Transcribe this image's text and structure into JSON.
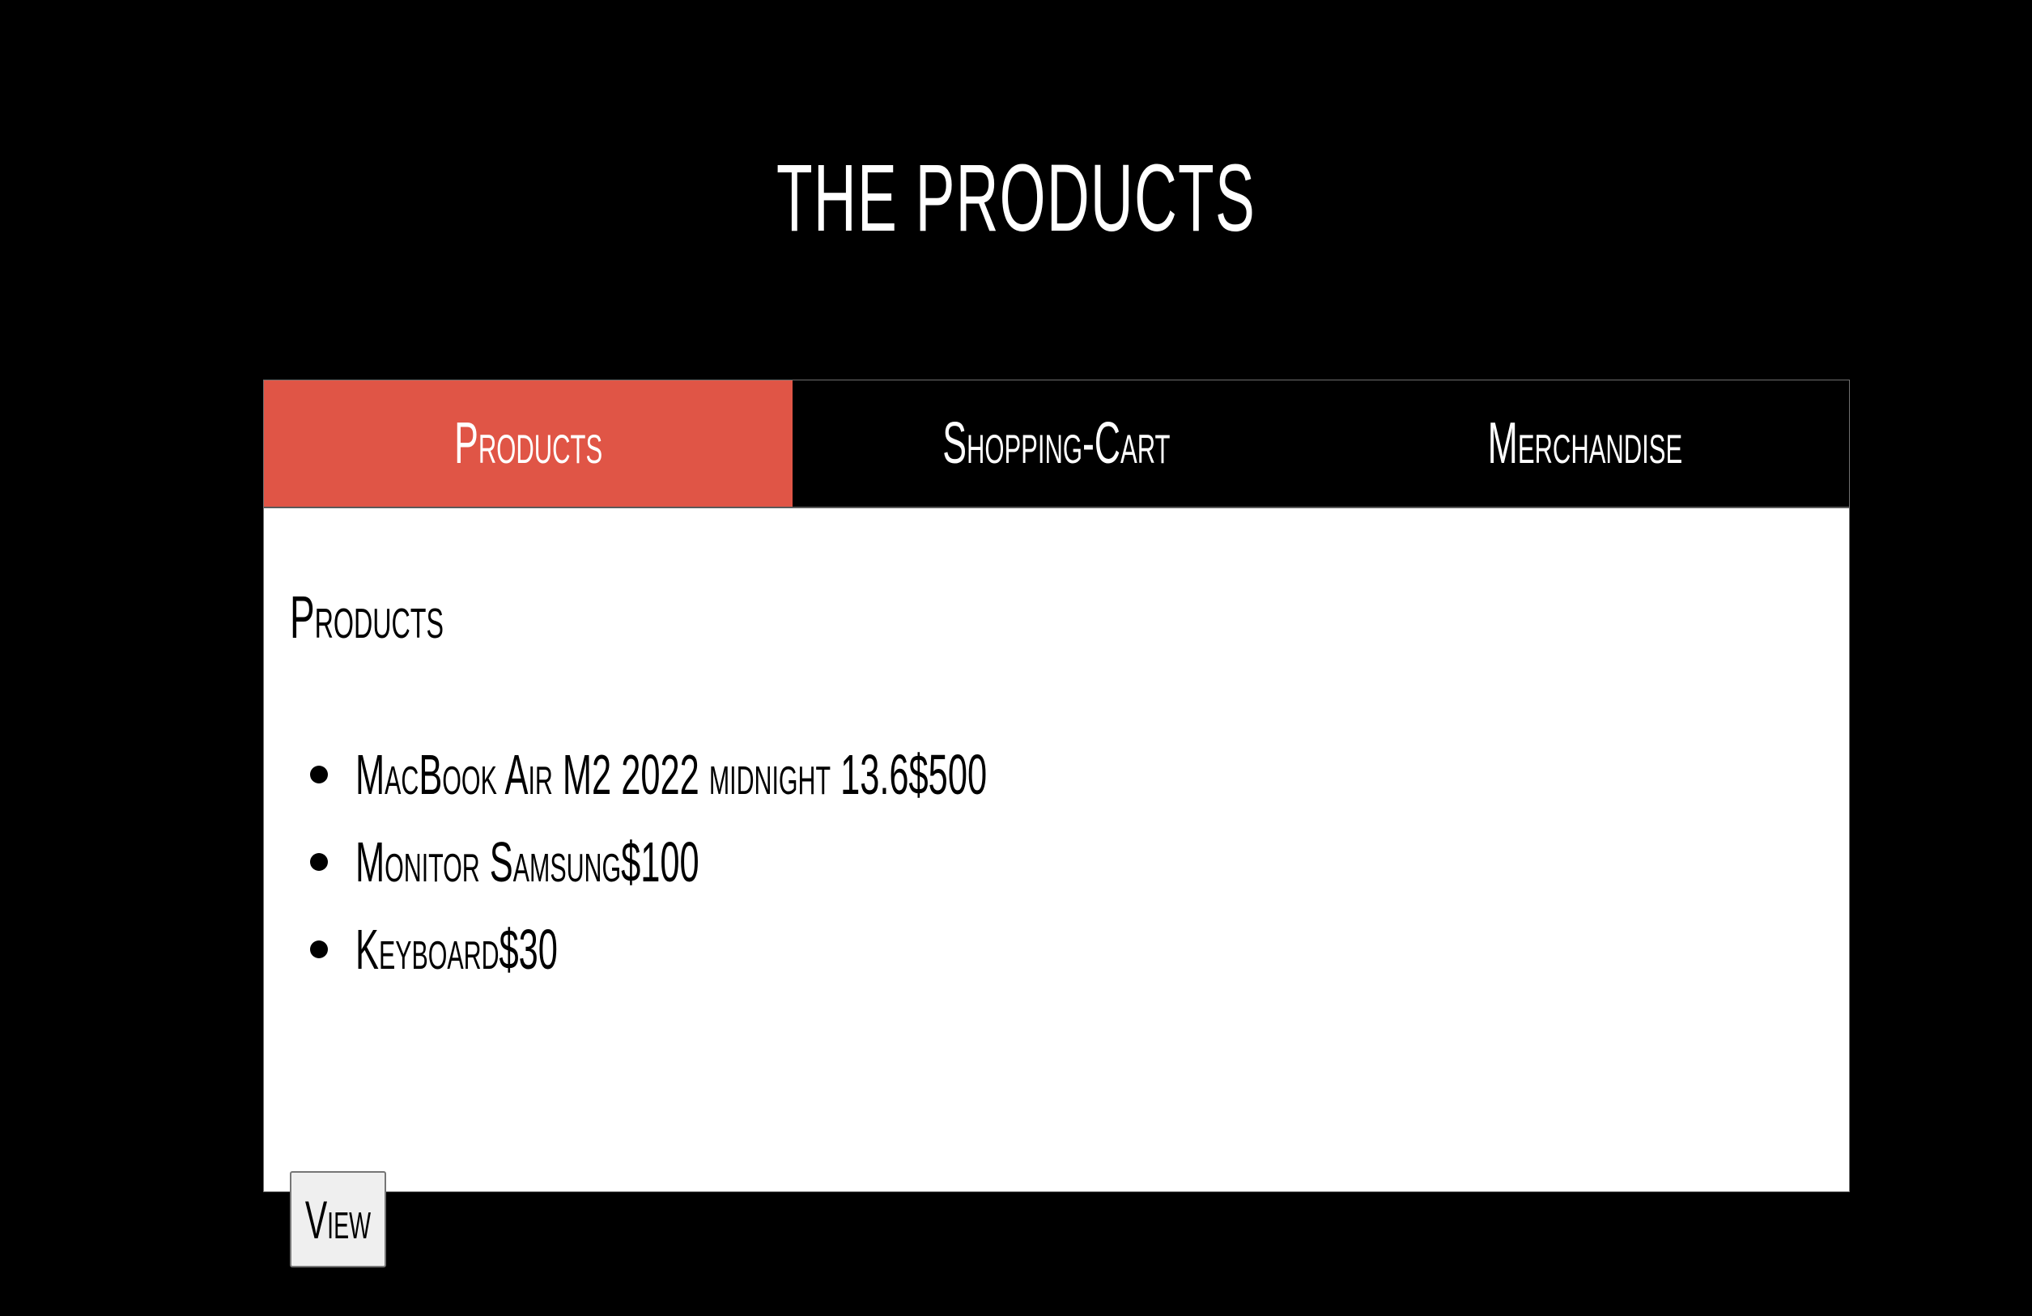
{
  "header": {
    "title": "THE PRODUCTS"
  },
  "tabs": [
    {
      "label": "Products",
      "active": true
    },
    {
      "label": "Shopping-Cart",
      "active": false
    },
    {
      "label": "Merchandise",
      "active": false
    }
  ],
  "content": {
    "heading": "Products",
    "items": [
      "MacBook Air M2 2022 midnight 13.6$500",
      "Monitor Samsung$100",
      "Keyboard$30"
    ],
    "view_button_label": "View"
  },
  "colors": {
    "background": "#000000",
    "active_tab": "#e05546",
    "panel": "#ffffff"
  }
}
